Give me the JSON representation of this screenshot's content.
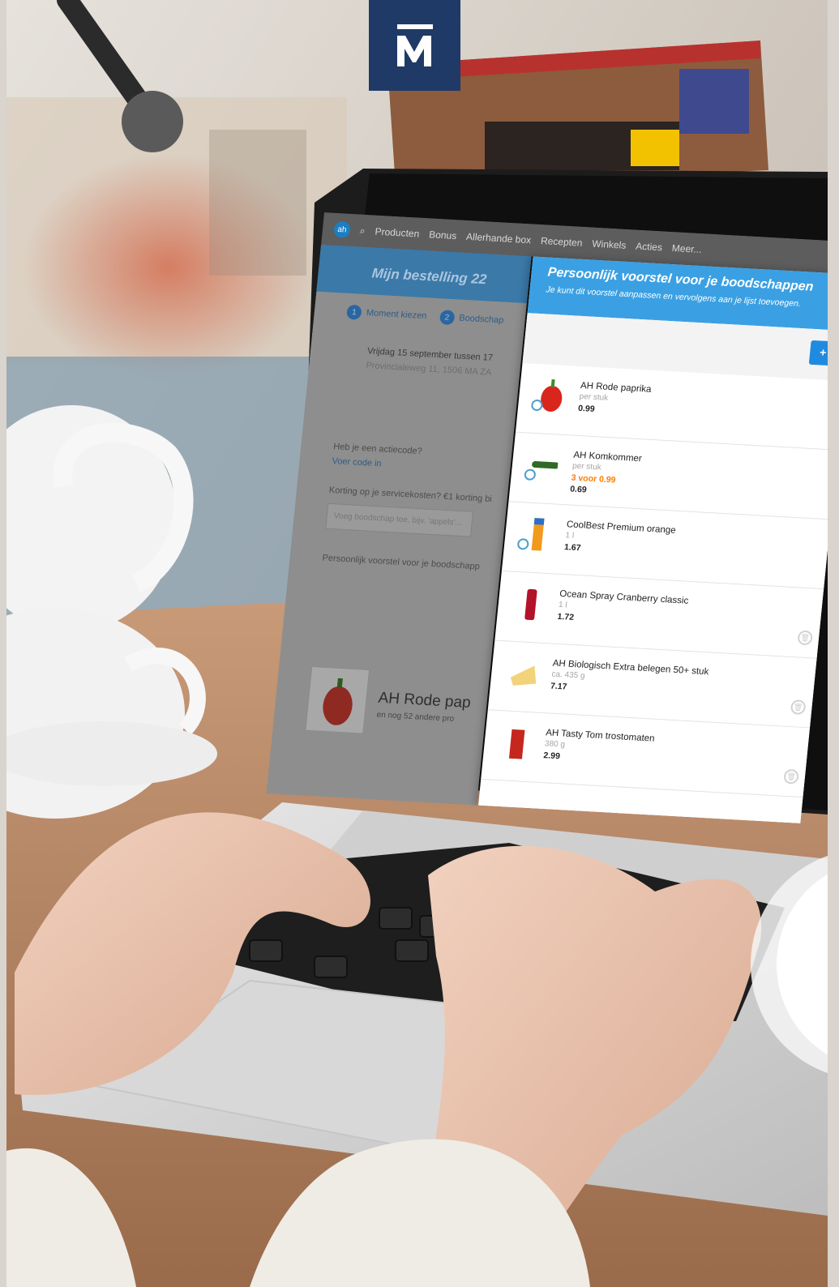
{
  "brand": {
    "logo_mark": "M"
  },
  "ah_site": {
    "nav": [
      "Producten",
      "Bonus",
      "Allerhande box",
      "Recepten",
      "Winkels",
      "Acties",
      "Meer..."
    ],
    "order_title": "Mijn bestelling 22",
    "steps": [
      {
        "num": "1",
        "label": "Moment kiezen"
      },
      {
        "num": "2",
        "label": "Boodschap"
      }
    ],
    "delivery": {
      "date_line": "Vrijdag 15 september tussen 17",
      "address": "Provincialeweg 11, 1506 MA ZA"
    },
    "promo_code_question": "Heb je een actiecode?",
    "promo_code_link": "Voer code in",
    "service_cost_line": "Korting op je servicekosten? €1 korting bi",
    "add_placeholder": "Voeg boodschap toe, bijv. 'appels'...",
    "suggestion_line": "Persoonlijk voorstel voor je boodschapp",
    "big_item_name": "AH Rode pap",
    "big_item_sub": "en nog 52 andere pro"
  },
  "panel": {
    "title": "Persoonlijk voorstel voor je boodschappen",
    "subtitle": "Je kunt dit voorstel aanpassen en vervolgens aan je lijst toevoegen.",
    "add_button": "+ V",
    "products": [
      {
        "name": "AH Rode paprika",
        "unit": "per stuk",
        "price": "0.99",
        "promo": ""
      },
      {
        "name": "AH Komkommer",
        "unit": "per stuk",
        "promo": "3 voor 0.99",
        "price": "0.69"
      },
      {
        "name": "CoolBest Premium orange",
        "unit": "1 l",
        "price": "1.67",
        "promo": ""
      },
      {
        "name": "Ocean Spray Cranberry classic",
        "unit": "1 l",
        "price": "1.72",
        "promo": ""
      },
      {
        "name": "AH Biologisch Extra belegen 50+ stuk",
        "unit": "ca. 435 g",
        "price": "7.17",
        "promo": ""
      },
      {
        "name": "AH Tasty Tom trostomaten",
        "unit": "380 g",
        "price": "2.99",
        "promo": ""
      }
    ]
  }
}
